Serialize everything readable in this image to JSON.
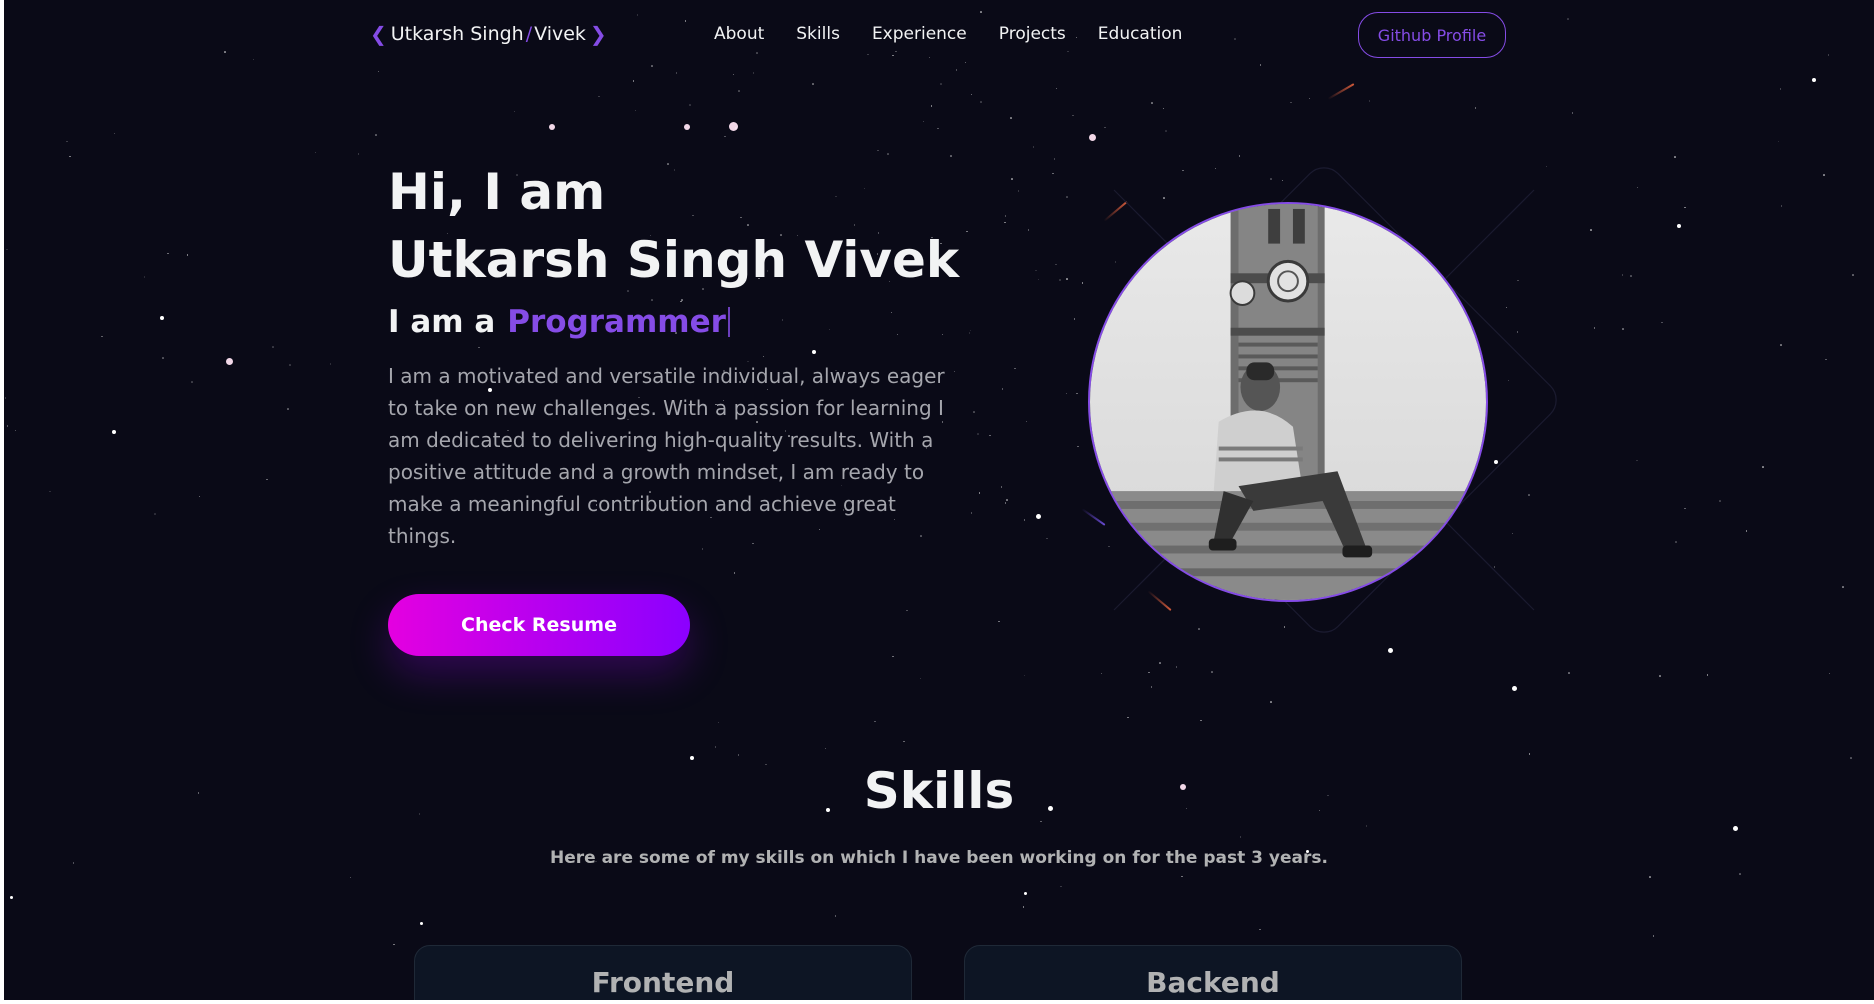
{
  "nav": {
    "logo_first": "Utkarsh Singh",
    "logo_slash": "/",
    "logo_second": "Vivek",
    "links": [
      "About",
      "Skills",
      "Experience",
      "Projects",
      "Education"
    ],
    "github_label": "Github Profile"
  },
  "hero": {
    "greeting": "Hi, I am",
    "name": "Utkarsh Singh Vivek",
    "typing_prefix": "I am a",
    "typing_role": "Programmer",
    "description": "I am a motivated and versatile individual, always eager to take on new challenges. With a passion for learning I am dedicated to delivering high-quality results. With a positive attitude and a growth mindset, I am ready to make a meaningful contribution and achieve great things.",
    "resume_label": "Check Resume"
  },
  "skills": {
    "title": "Skills",
    "subtitle": "Here are some of my skills on which I have been working on for the past 3 years.",
    "cards": [
      "Frontend",
      "Backend"
    ]
  },
  "colors": {
    "background": "#0a0a17",
    "primary": "#854ce6",
    "text_primary": "#f2f3f4",
    "text_secondary": "#b1b2b3",
    "button_gradient_start": "#e400e0",
    "button_gradient_end": "#8b00ff"
  },
  "icons": {
    "logo_left": "chevron-left-icon",
    "logo_right": "chevron-right-icon"
  }
}
